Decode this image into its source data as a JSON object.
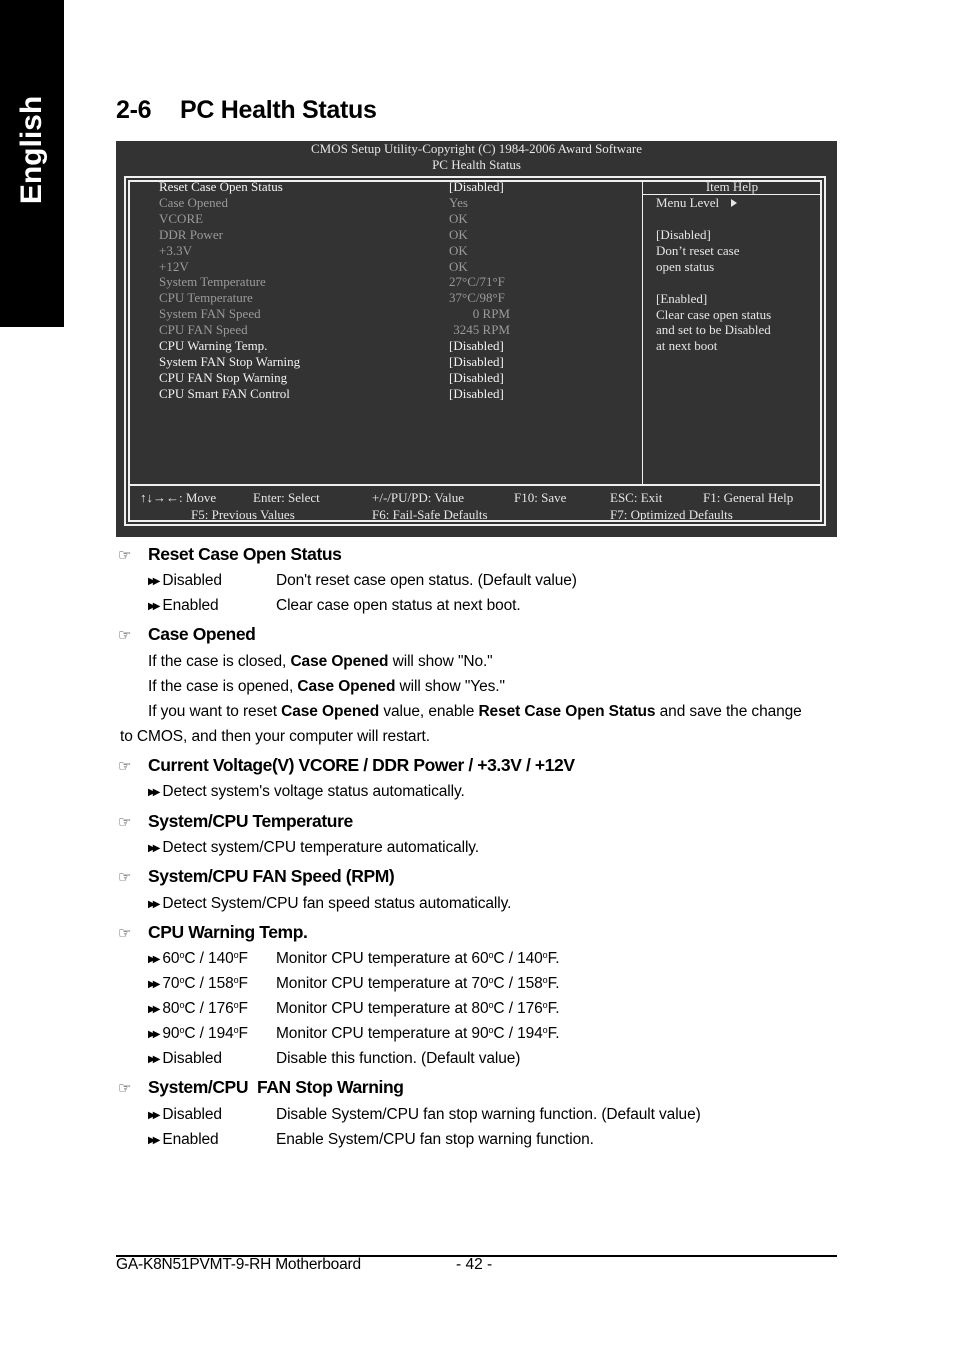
{
  "side_tab": {
    "label": "English"
  },
  "section": {
    "number": "2-6",
    "title": "PC Health Status"
  },
  "bios": {
    "header_line1": "CMOS Setup Utility-Copyright (C) 1984-2006 Award Software",
    "header_line2": "PC Health Status",
    "items": [
      {
        "label": "Reset Case Open Status",
        "value": "[Disabled]",
        "state": "active"
      },
      {
        "label": "Case Opened",
        "value": "Yes",
        "state": "dim"
      },
      {
        "label": "VCORE",
        "value": "OK",
        "state": "dim"
      },
      {
        "label": "DDR Power",
        "value": "OK",
        "state": "dim"
      },
      {
        "label": "+3.3V",
        "value": "OK",
        "state": "dim"
      },
      {
        "label": "+12V",
        "value": "OK",
        "state": "dim"
      },
      {
        "label": "System Temperature",
        "value": "27°C/71°F",
        "state": "dim"
      },
      {
        "label": "CPU Temperature",
        "value": "37°C/98°F",
        "state": "dim"
      },
      {
        "label": "System FAN Speed",
        "value": "0 RPM",
        "state": "dim"
      },
      {
        "label": "CPU FAN Speed",
        "value": "3245 RPM",
        "state": "dim"
      },
      {
        "label": "CPU Warning Temp.",
        "value": "[Disabled]",
        "state": "active"
      },
      {
        "label": "System FAN Stop Warning",
        "value": "[Disabled]",
        "state": "active"
      },
      {
        "label": "CPU FAN Stop Warning",
        "value": "[Disabled]",
        "state": "active"
      },
      {
        "label": "CPU Smart FAN Control",
        "value": "[Disabled]",
        "state": "active"
      }
    ],
    "help": {
      "title": "Item Help",
      "menu_level": "Menu Level",
      "lines": [
        "[Disabled]",
        "Don’t reset case",
        "open status",
        "",
        "[Enabled]",
        "Clear case open status",
        "and set to be Disabled",
        "at next boot"
      ]
    },
    "footer": {
      "move": "↑↓→←: Move",
      "select": "Enter: Select",
      "value": "+/-/PU/PD: Value",
      "save": "F10: Save",
      "exit": "ESC: Exit",
      "general_help": "F1: General Help",
      "previous": "F5: Previous Values",
      "failsafe": "F6: Fail-Safe Defaults",
      "optimized": "F7: Optimized Defaults"
    }
  },
  "doc": {
    "reset_case": {
      "title": "Reset Case Open Status",
      "options": [
        {
          "name": "Disabled",
          "desc": "Don't reset case open status. (Default value)"
        },
        {
          "name": "Enabled",
          "desc": "Clear case open status at next boot."
        }
      ]
    },
    "case_opened": {
      "title": "Case Opened",
      "l1_a": "If the case is closed, ",
      "l1_b": "Case Opened",
      "l1_c": " will show \"No.\"",
      "l2_a": "If the case is opened, ",
      "l2_b": "Case Opened",
      "l2_c": " will show \"Yes.\"",
      "l3_a": "If you want to reset ",
      "l3_b": "Case Opened",
      "l3_c": " value, enable ",
      "l3_d": "Reset Case Open Status",
      "l3_e": " and save the change",
      "l4": "to CMOS, and then your computer will restart."
    },
    "voltage": {
      "title": "Current Voltage(V) VCORE / DDR Power / +3.3V / +12V",
      "desc": "Detect system's voltage status automatically."
    },
    "temperature": {
      "title": "System/CPU Temperature",
      "desc": "Detect system/CPU temperature automatically."
    },
    "fan_speed": {
      "title": "System/CPU FAN Speed (RPM)",
      "desc": "Detect System/CPU fan speed status automatically."
    },
    "warning_temp": {
      "title": "CPU Warning Temp.",
      "options": [
        {
          "c": "60",
          "f": "140"
        },
        {
          "c": "70",
          "f": "158"
        },
        {
          "c": "80",
          "f": "176"
        },
        {
          "c": "90",
          "f": "194"
        }
      ],
      "monitor_prefix": "Monitor CPU temperature at ",
      "disabled_name": "Disabled",
      "disabled_desc": "Disable this function. (Default value)"
    },
    "fan_stop": {
      "title": "System/CPU  FAN Stop Warning",
      "options": [
        {
          "name": "Disabled",
          "desc": "Disable System/CPU fan stop warning function. (Default value)"
        },
        {
          "name": "Enabled",
          "desc": "Enable System/CPU fan stop warning function."
        }
      ]
    }
  },
  "page_footer": {
    "model": "GA-K8N51PVMT-9-RH Motherboard",
    "page": "- 42 -"
  }
}
